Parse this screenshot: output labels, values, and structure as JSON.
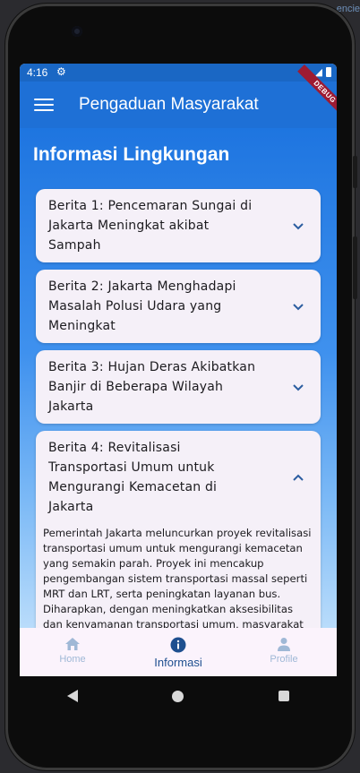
{
  "ide": {
    "hint": "encie"
  },
  "status_bar": {
    "time": "4:16",
    "settings_icon": "gear-icon",
    "right": "▾◢"
  },
  "app_bar": {
    "title": "Pengaduan Masyarakat",
    "menu_icon": "menu-icon",
    "debug_banner": "DEBUG"
  },
  "page": {
    "title": "Informasi Lingkungan"
  },
  "news": [
    {
      "title": "Berita 1: Pencemaran Sungai di Jakarta Meningkat akibat Sampah",
      "expanded": false
    },
    {
      "title": "Berita 2: Jakarta Menghadapi Masalah Polusi Udara yang Meningkat",
      "expanded": false
    },
    {
      "title": "Berita 3: Hujan Deras Akibatkan Banjir di Beberapa Wilayah Jakarta",
      "expanded": false
    },
    {
      "title": "Berita 4: Revitalisasi Transportasi Umum untuk Mengurangi Kemacetan di Jakarta",
      "expanded": true,
      "body": "Pemerintah Jakarta meluncurkan proyek revitalisasi transportasi umum untuk mengurangi kemacetan yang semakin parah. Proyek ini mencakup pengembangan sistem transportasi massal seperti MRT dan LRT, serta peningkatan layanan bus. Diharapkan, dengan meningkatkan aksesibilitas dan kenyamanan transportasi umum, masyarakat akan lebih memilih untuk menggunakan transportasi publik daripada kendaraan pribadi."
    }
  ],
  "bottom_nav": [
    {
      "label": "Home",
      "icon": "home-icon",
      "active": false
    },
    {
      "label": "Informasi",
      "icon": "info-icon",
      "active": true
    },
    {
      "label": "Profile",
      "icon": "person-icon",
      "active": false
    }
  ],
  "colors": {
    "appbar": "#1e70d6",
    "active_nav": "#1e4f8f",
    "inactive_nav": "#9fb8d6",
    "card": "#f5f0f8"
  }
}
